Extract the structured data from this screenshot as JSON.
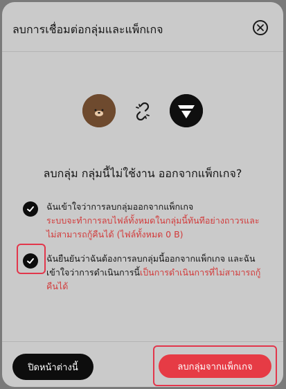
{
  "dialog": {
    "title": "ลบการเชื่อมต่อกลุ่มและแพ็กเกจ",
    "question": "ลบกลุ่ม กลุ่มนี้ไม่ใช้งาน ออกจากแพ็กเกจ?",
    "checks": [
      {
        "text": "ฉันเข้าใจว่าการลบกลุ่มออกจากแพ็กเกจ",
        "warning": "ระบบจะทำการลบไฟล์ทั้งหมดในกลุ่มนี้ทันทีอย่างถาวรและไม่สามารถกู้คืนได้ (ไฟล์ทั้งหมด 0 B)"
      },
      {
        "text": "ฉันยืนยันว่าฉันต้องการลบกลุ่มนี้ออกจากแพ็กเกจ และฉันเข้าใจว่าการดำเนินการนี้",
        "warning": "เป็นการดำเนินการที่ไม่สามารถกู้คืนได้"
      }
    ]
  },
  "footer": {
    "close_label": "ปิดหน้าต่างนี้",
    "remove_label": "ลบกลุ่มจากแพ็กเกจ"
  },
  "colors": {
    "overlay": "#7a7a7a",
    "dialog_bg": "#cacaca",
    "accent_red": "#e63b45",
    "warning_text": "#d23a3a",
    "dark": "#0d0d0d"
  },
  "icons": [
    "close-icon",
    "group-avatar-icon",
    "unlink-icon",
    "brand-logo-icon",
    "check-icon"
  ]
}
